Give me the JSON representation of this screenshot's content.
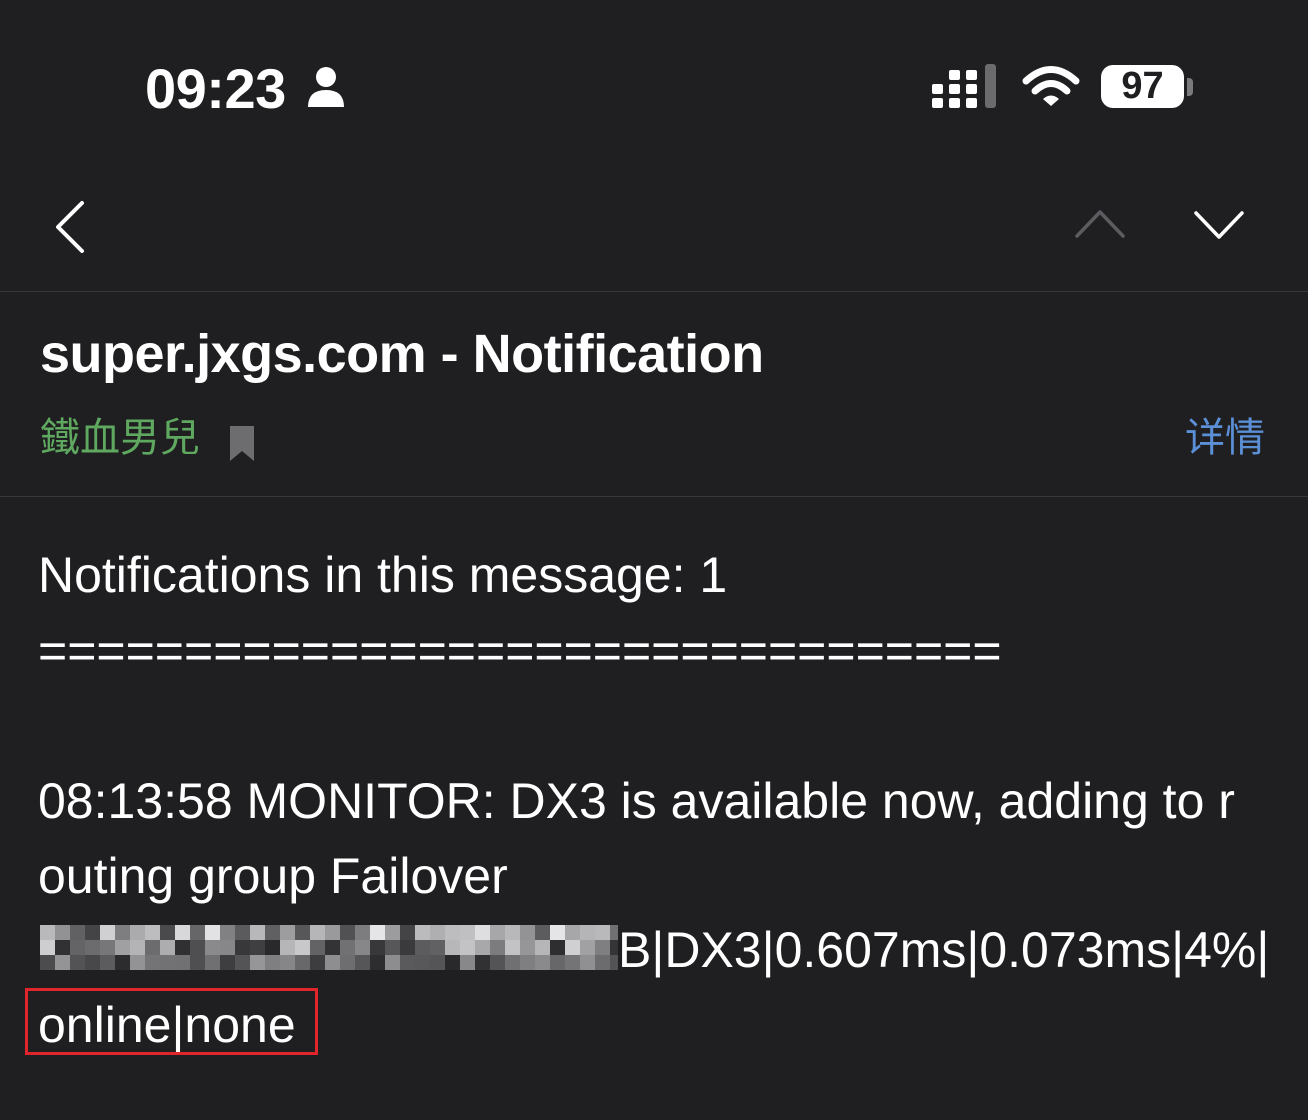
{
  "status_bar": {
    "time": "09:23",
    "battery_level": "97",
    "icons": [
      "person-icon",
      "signal-icon",
      "wifi-icon",
      "battery-icon"
    ]
  },
  "nav": {
    "icons": {
      "back": "chevron-left-icon",
      "previous": "chevron-up-icon",
      "next": "chevron-down-icon"
    },
    "previous_enabled": false,
    "next_enabled": true
  },
  "message": {
    "subject": "super.jxgs.com - Notification",
    "sender": "鐵血男兒",
    "details_link": "详情",
    "bookmark_icon": "bookmark-icon"
  },
  "body": {
    "summary": "Notifications in this message: 1",
    "separator": "=================================",
    "event_line_1": "08:13:58 MONITOR: DX3 is available now, adding to r",
    "event_line_2": "outing group Failover",
    "event_line_3_visible": "B|DX3|0.607ms|0.073ms|4%|",
    "event_line_4": "online|none"
  },
  "annotation": {
    "color": "#e0262b"
  },
  "colors": {
    "background": "#1f1f21",
    "divider": "#38383a",
    "sender": "#5fa85f",
    "link": "#5b8fd6",
    "disabled_icon": "#5c5c60"
  }
}
